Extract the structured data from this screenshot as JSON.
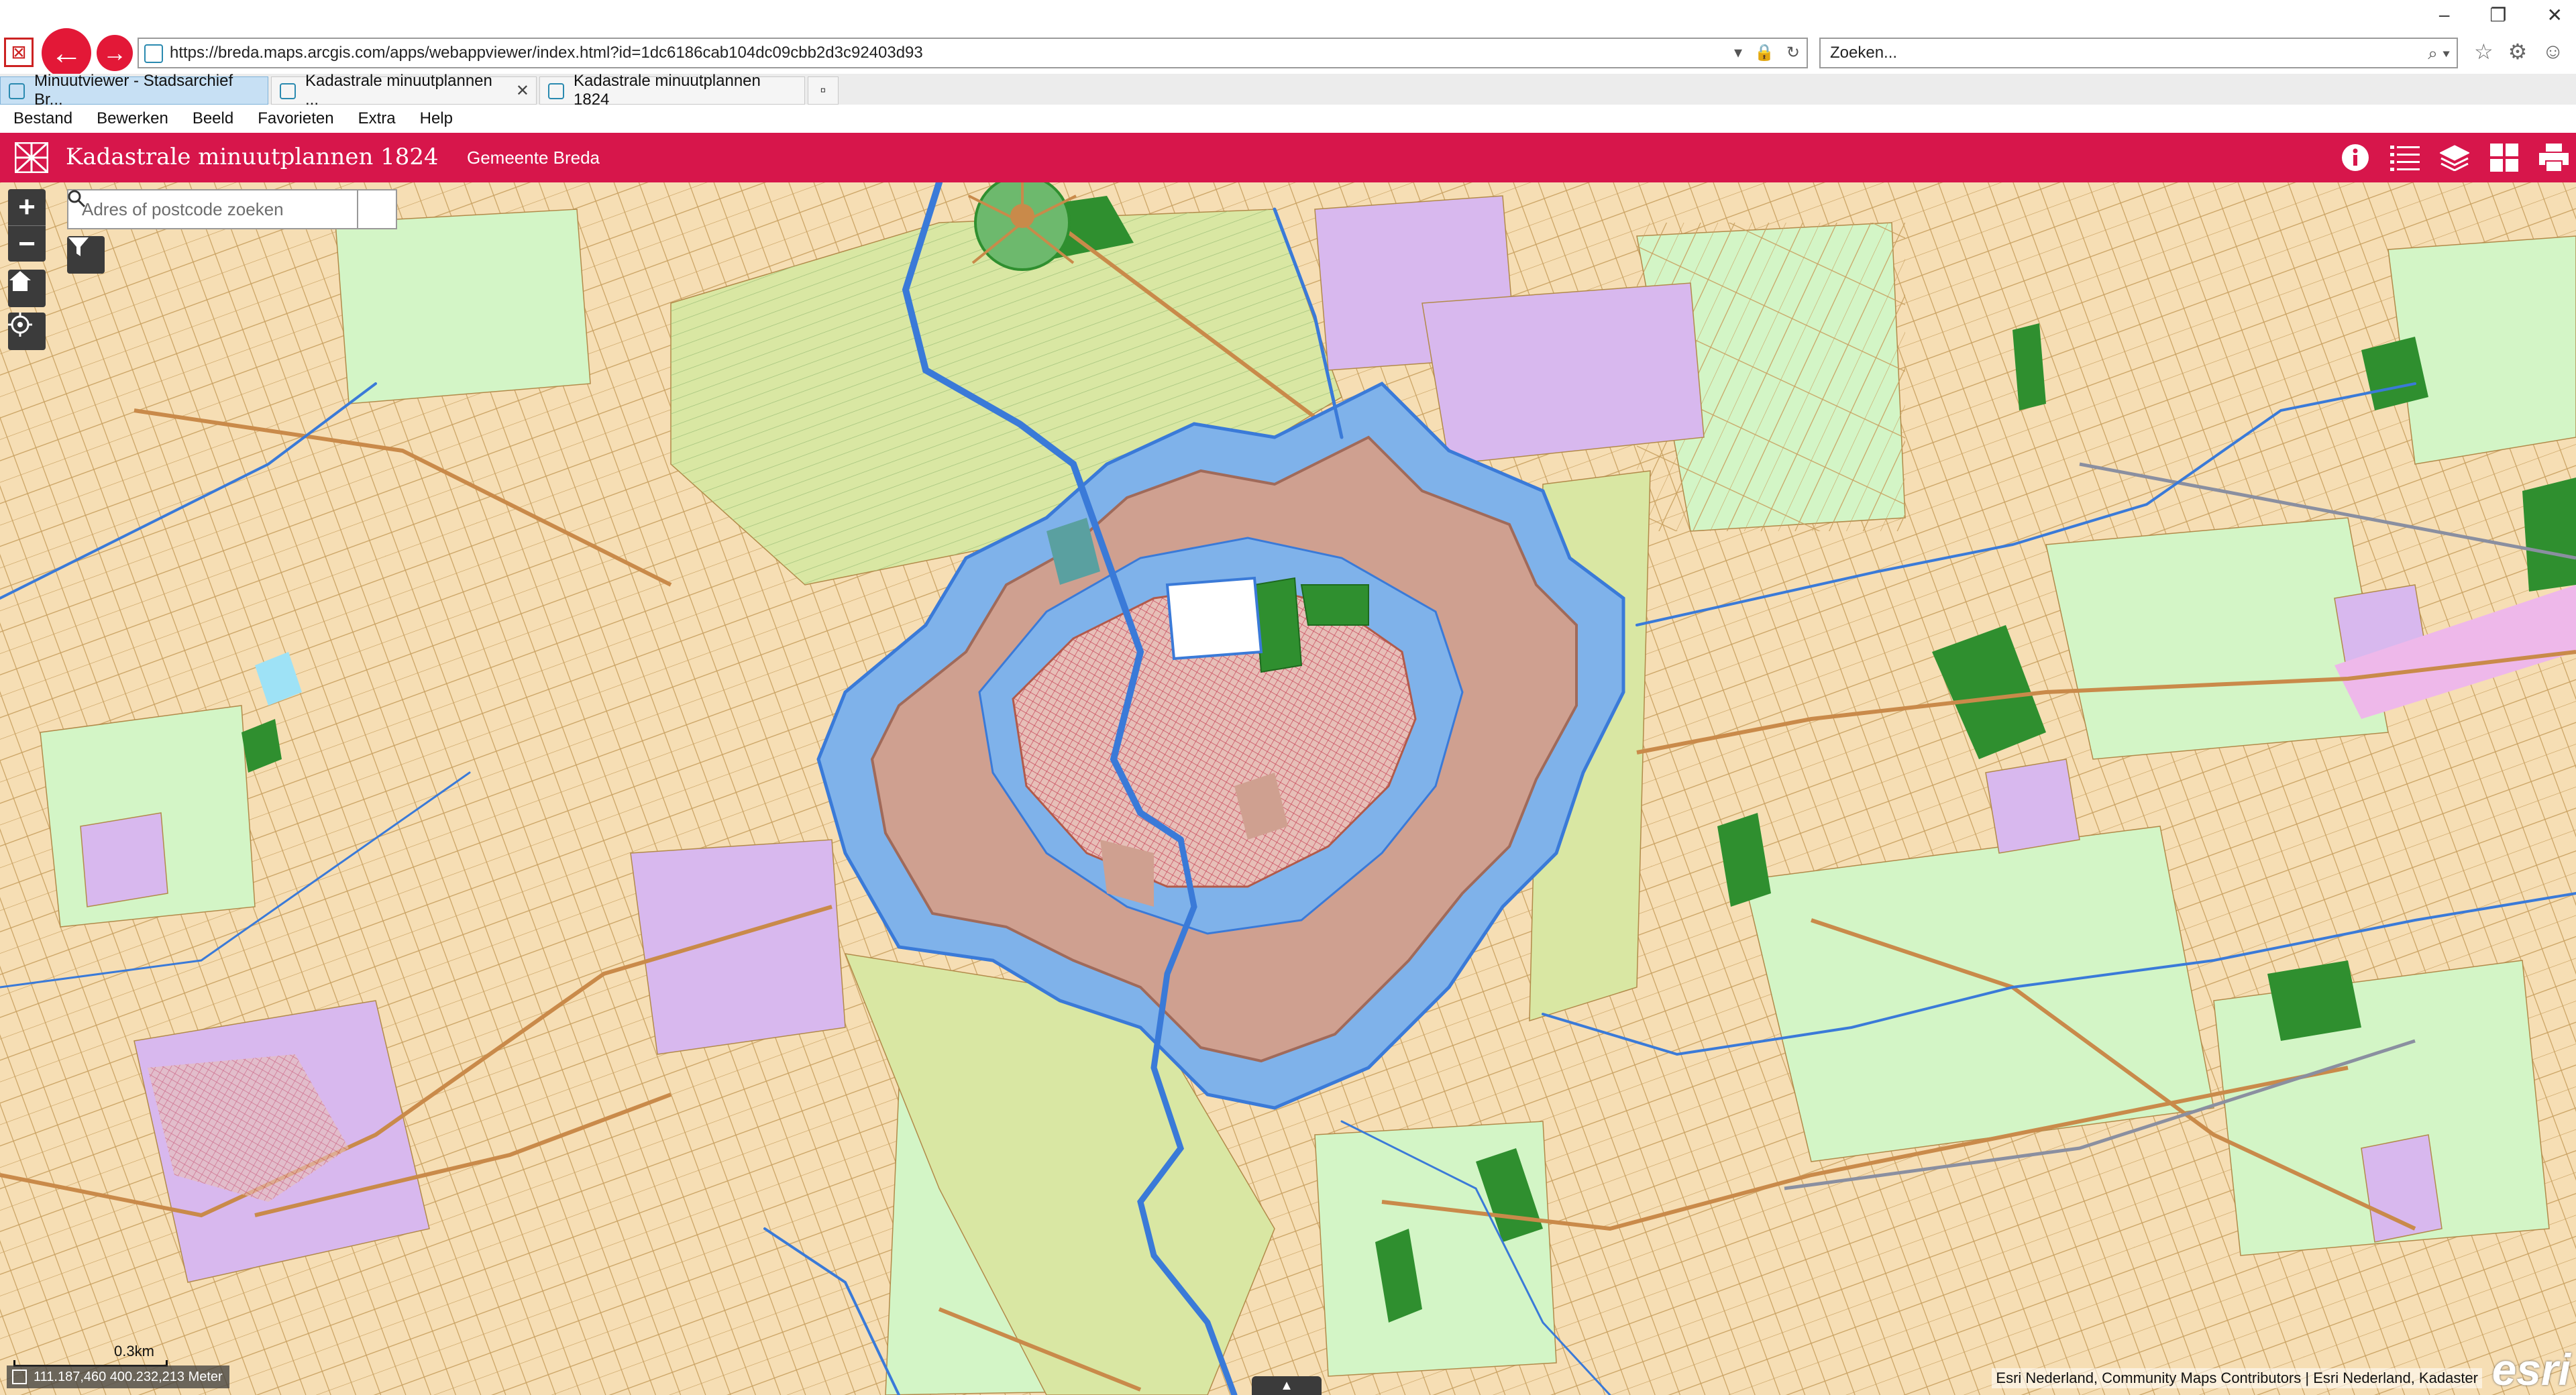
{
  "browser": {
    "url": "https://breda.maps.arcgis.com/apps/webappviewer/index.html?id=1dc6186cab104dc09cbb2d3c92403d93",
    "search_placeholder": "Zoeken...",
    "tabs": [
      {
        "label": "Minuutviewer - Stadsarchief Br...",
        "active": true
      },
      {
        "label": "Kadastrale minuutplannen ...",
        "active": false,
        "closable": true
      },
      {
        "label": "Kadastrale minuutplannen 1824",
        "active": false
      }
    ],
    "menu": [
      "Bestand",
      "Bewerken",
      "Beeld",
      "Favorieten",
      "Extra",
      "Help"
    ]
  },
  "app": {
    "title": "Kadastrale minuutplannen 1824",
    "subtitle": "Gemeente Breda",
    "header_color": "#d7164b",
    "tools": [
      "info-icon",
      "legend-list-icon",
      "layers-icon",
      "basemap-grid-icon",
      "print-icon"
    ]
  },
  "map": {
    "search_placeholder": "Adres of postcode zoeken",
    "scale_label": "0.3km",
    "coordinates": "111.187,460 400.232,213 Meter",
    "attribution": "Esri Nederland, Community Maps Contributors | Esri Nederland, Kadaster",
    "logo": "esri",
    "colors": {
      "farmland": "#f6deb4",
      "pasture": "#d3f5c6",
      "forest": "#2f8f2f",
      "heath": "#d8b8ee",
      "grass": "#c6dd8a",
      "fortress": "#cfa090",
      "moat": "#7fb2ea",
      "water_line": "#3a7ad8",
      "road": "#c98a4a",
      "parcel_line": "#b28a4a"
    }
  }
}
